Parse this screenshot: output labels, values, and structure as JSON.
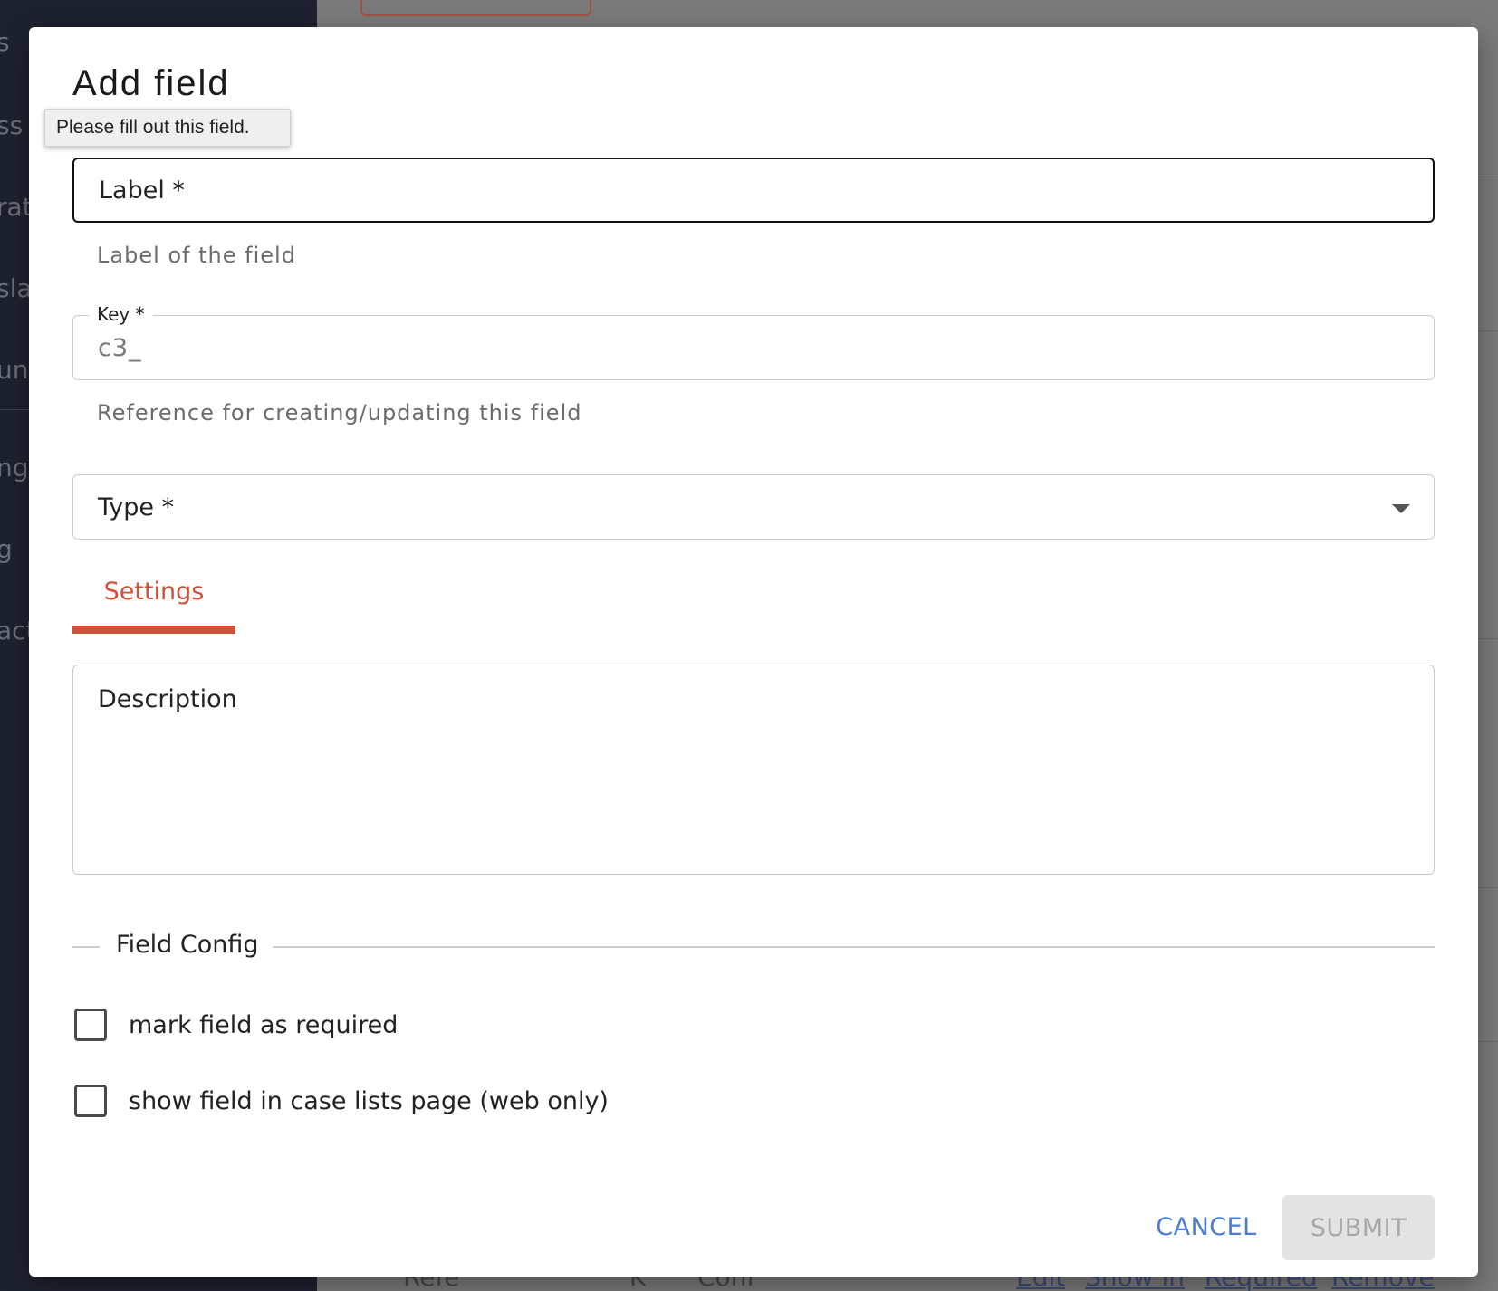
{
  "background": {
    "sidebar_fragments": [
      "s",
      "ss (",
      "rat",
      "slat",
      "un",
      "ngs",
      "g",
      "act"
    ],
    "bottom_row": [
      "Réfé",
      "K",
      "Conf",
      "Edit",
      "Show in",
      "Required",
      "Remove"
    ]
  },
  "modal": {
    "title": "Add field",
    "tooltip": "Please fill out this field.",
    "label_field": {
      "label": "Label *",
      "helper": "Label of the field"
    },
    "key_field": {
      "legend": "Key *",
      "value": "c3_",
      "helper": "Reference for creating/updating this field"
    },
    "type_field": {
      "label": "Type *"
    },
    "tabs": [
      {
        "label": "Settings",
        "active": true
      }
    ],
    "description_field": {
      "label": "Description"
    },
    "field_config": {
      "title": "Field Config",
      "options": [
        {
          "label": "mark field as required",
          "checked": false
        },
        {
          "label": "show field in case lists page (web only)",
          "checked": false
        }
      ]
    },
    "actions": {
      "cancel": "CANCEL",
      "submit": "SUBMIT"
    }
  },
  "colors": {
    "accent": "#d1503a",
    "link": "#4b7bd6",
    "sidebar": "#1e2230",
    "disabled": "#e3e3e3"
  }
}
